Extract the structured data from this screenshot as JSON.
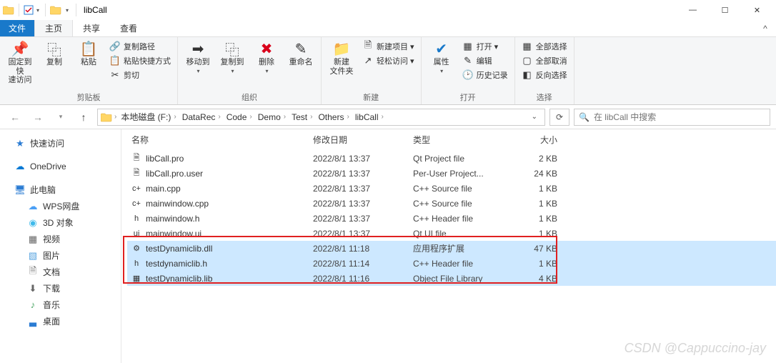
{
  "window": {
    "title": "libCall",
    "min": "—",
    "max": "☐",
    "close": "✕"
  },
  "menubar": {
    "file": "文件",
    "tabs": [
      {
        "label": "主页",
        "active": true
      },
      {
        "label": "共享",
        "active": false
      },
      {
        "label": "查看",
        "active": false
      }
    ]
  },
  "ribbon": {
    "groups": [
      {
        "label": "剪贴板",
        "big": [
          {
            "icon": "📌",
            "label": "固定到快\n速访问"
          },
          {
            "icon": "⿻",
            "label": "复制"
          },
          {
            "icon": "📋",
            "label": "粘贴"
          }
        ],
        "small": [
          {
            "icon": "🔗",
            "label": "复制路径"
          },
          {
            "icon": "📋",
            "label": "粘贴快捷方式"
          },
          {
            "icon": "✂",
            "label": "剪切"
          }
        ]
      },
      {
        "label": "组织",
        "big": [
          {
            "icon": "➡",
            "label": "移动到",
            "caret": true
          },
          {
            "icon": "⿻",
            "label": "复制到",
            "caret": true
          },
          {
            "icon": "✖",
            "label": "删除",
            "caret": true,
            "color": "#d9001b"
          },
          {
            "icon": "✎",
            "label": "重命名"
          }
        ],
        "small": []
      },
      {
        "label": "新建",
        "big": [
          {
            "icon": "📁",
            "label": "新建\n文件夹"
          }
        ],
        "small": [
          {
            "icon": "🗎",
            "label": "新建项目 ▾"
          },
          {
            "icon": "↗",
            "label": "轻松访问 ▾"
          }
        ]
      },
      {
        "label": "打开",
        "big": [
          {
            "icon": "✔",
            "label": "属性",
            "caret": true,
            "color": "#1979ca"
          }
        ],
        "small": [
          {
            "icon": "▦",
            "label": "打开 ▾"
          },
          {
            "icon": "✎",
            "label": "编辑"
          },
          {
            "icon": "🕑",
            "label": "历史记录"
          }
        ]
      },
      {
        "label": "选择",
        "big": [],
        "small": [
          {
            "icon": "▦",
            "label": "全部选择"
          },
          {
            "icon": "▢",
            "label": "全部取消"
          },
          {
            "icon": "◧",
            "label": "反向选择"
          }
        ]
      }
    ]
  },
  "breadcrumbs": {
    "items": [
      "本地磁盘 (F:)",
      "DataRec",
      "Code",
      "Demo",
      "Test",
      "Others",
      "libCall"
    ]
  },
  "search": {
    "placeholder": "在 libCall 中搜索"
  },
  "sidebar": {
    "items": [
      {
        "icon": "★",
        "color": "#2b7cd3",
        "label": "快速访问",
        "indent": false
      },
      {
        "spacer": true
      },
      {
        "icon": "☁",
        "color": "#0078d4",
        "label": "OneDrive",
        "indent": false
      },
      {
        "spacer": true
      },
      {
        "icon": "🖥",
        "color": "#2b7cd3",
        "label": "此电脑",
        "indent": false
      },
      {
        "icon": "☁",
        "color": "#4a9ff5",
        "label": "WPS网盘",
        "indent": true
      },
      {
        "icon": "◉",
        "color": "#3fbaeb",
        "label": "3D 对象",
        "indent": true
      },
      {
        "icon": "▦",
        "color": "#666",
        "label": "视频",
        "indent": true
      },
      {
        "icon": "▧",
        "color": "#5aa5e0",
        "label": "图片",
        "indent": true
      },
      {
        "icon": "🗎",
        "color": "#666",
        "label": "文档",
        "indent": true
      },
      {
        "icon": "⬇",
        "color": "#666",
        "label": "下载",
        "indent": true
      },
      {
        "icon": "♪",
        "color": "#4aa564",
        "label": "音乐",
        "indent": true
      },
      {
        "icon": "▃",
        "color": "#2b7cd3",
        "label": "桌面",
        "indent": true
      }
    ]
  },
  "filelist": {
    "headers": {
      "name": "名称",
      "date": "修改日期",
      "type": "类型",
      "size": "大小"
    },
    "rows": [
      {
        "icon": "🗎",
        "name": "libCall.pro",
        "date": "2022/8/1 13:37",
        "type": "Qt Project file",
        "size": "2 KB",
        "selected": false
      },
      {
        "icon": "🗎",
        "name": "libCall.pro.user",
        "date": "2022/8/1 13:37",
        "type": "Per-User Project...",
        "size": "24 KB",
        "selected": false
      },
      {
        "icon": "c+",
        "name": "main.cpp",
        "date": "2022/8/1 13:37",
        "type": "C++ Source file",
        "size": "1 KB",
        "selected": false
      },
      {
        "icon": "c+",
        "name": "mainwindow.cpp",
        "date": "2022/8/1 13:37",
        "type": "C++ Source file",
        "size": "1 KB",
        "selected": false
      },
      {
        "icon": "h",
        "name": "mainwindow.h",
        "date": "2022/8/1 13:37",
        "type": "C++ Header file",
        "size": "1 KB",
        "selected": false
      },
      {
        "icon": "ui",
        "name": "mainwindow.ui",
        "date": "2022/8/1 13:37",
        "type": "Qt UI file",
        "size": "1 KB",
        "selected": false
      },
      {
        "icon": "⚙",
        "name": "testDynamiclib.dll",
        "date": "2022/8/1 11:18",
        "type": "应用程序扩展",
        "size": "47 KB",
        "selected": true
      },
      {
        "icon": "h",
        "name": "testdynamiclib.h",
        "date": "2022/8/1 11:14",
        "type": "C++ Header file",
        "size": "1 KB",
        "selected": true
      },
      {
        "icon": "▦",
        "name": "testDynamiclib.lib",
        "date": "2022/8/1 11:16",
        "type": "Object File Library",
        "size": "4 KB",
        "selected": true
      }
    ]
  },
  "watermark": "CSDN @Cappuccino-jay"
}
